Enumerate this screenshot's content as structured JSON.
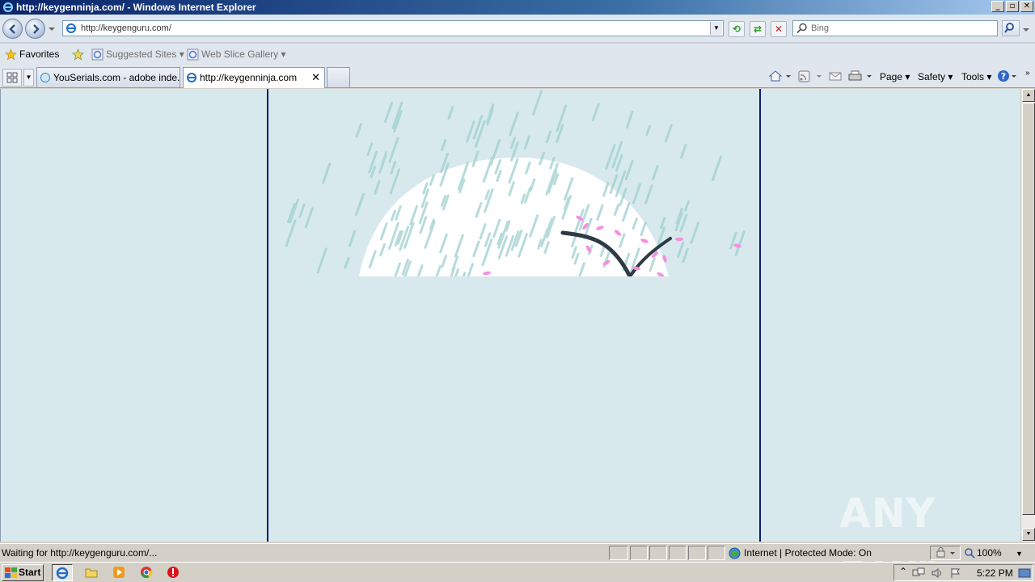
{
  "window": {
    "title": "http://keygenninja.com/ - Windows Internet Explorer",
    "controls": [
      "minimize",
      "restore",
      "close"
    ]
  },
  "address_bar": {
    "url": "http://keygenguru.com/",
    "search_placeholder": "Bing"
  },
  "favorites_bar": {
    "favorites_label": "Favorites",
    "items": [
      {
        "label": "Suggested Sites"
      },
      {
        "label": "Web Slice Gallery"
      }
    ]
  },
  "tabs": [
    {
      "label": "YouSerials.com - adobe inde...",
      "active": false
    },
    {
      "label": "http://keygenninja.com",
      "active": true
    }
  ],
  "command_bar": {
    "page": "Page",
    "safety": "Safety",
    "tools": "Tools"
  },
  "status_bar": {
    "text": "Waiting for http://keygenguru.com/...",
    "zone": "Internet | Protected Mode: On",
    "zoom": "100%"
  },
  "taskbar": {
    "start_label": "Start",
    "clock": "5:22 PM"
  },
  "watermark": "ANY RUN",
  "colors": {
    "page_background": "#d8e9ee",
    "column_border": "#0b1a7a",
    "rain": "#9fd0cf",
    "petals": "#f48fe0",
    "branch": "#2f3a44"
  }
}
